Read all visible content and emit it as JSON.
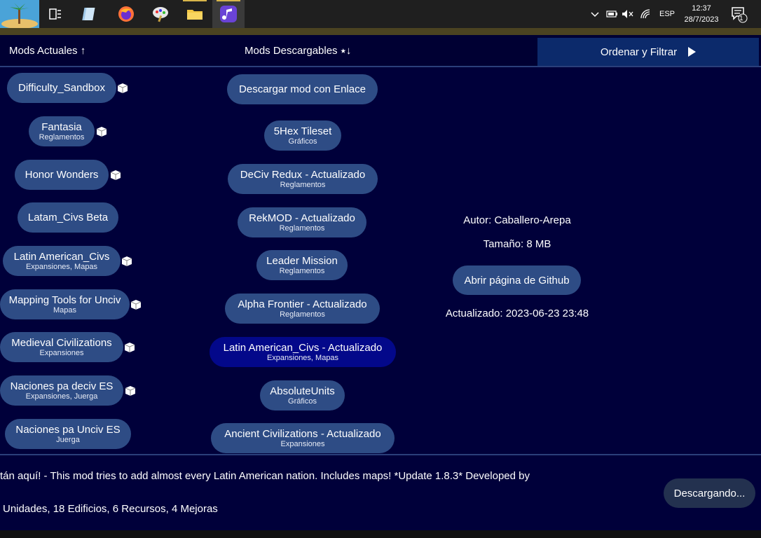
{
  "taskbar": {
    "apps": [
      {
        "icon": "island-icon",
        "name": "game-app"
      },
      {
        "icon": "task-view-icon",
        "name": "task-view"
      },
      {
        "icon": "notebook-icon",
        "name": "notes-app"
      },
      {
        "icon": "firefox-icon",
        "name": "firefox"
      },
      {
        "icon": "paint-icon",
        "name": "paint-app"
      },
      {
        "icon": "folder-icon",
        "name": "file-explorer"
      },
      {
        "icon": "music-icon",
        "name": "music-app"
      }
    ],
    "language": "ESP",
    "time": "12:37",
    "date": "28/7/2023",
    "notification_count": "1"
  },
  "header": {
    "current_mods": "Mods Actuales ↑",
    "downloadable_mods": "Mods Descargables ⭑↓",
    "order_filter": "Ordenar y Filtrar"
  },
  "current_mods": [
    {
      "title": "Difficulty_Sandbox",
      "subtitle": "",
      "installed": true
    },
    {
      "title": "Fantasia",
      "subtitle": "Reglamentos",
      "installed": true
    },
    {
      "title": "Honor Wonders",
      "subtitle": "",
      "installed": true
    },
    {
      "title": "Latam_Civs Beta",
      "subtitle": "",
      "installed": false
    },
    {
      "title": "Latin American_Civs",
      "subtitle": "Expansiones, Mapas",
      "installed": true
    },
    {
      "title": "Mapping Tools for Unciv",
      "subtitle": "Mapas",
      "installed": true
    },
    {
      "title": "Medieval Civilizations",
      "subtitle": "Expansiones",
      "installed": true
    },
    {
      "title": "Naciones pa deciv ES",
      "subtitle": "Expansiones, Juerga",
      "installed": true
    },
    {
      "title": "Naciones pa Unciv ES",
      "subtitle": "Juerga",
      "installed": false
    }
  ],
  "downloadable_mods": [
    {
      "title": "Descargar mod con Enlace",
      "subtitle": ""
    },
    {
      "title": "5Hex Tileset",
      "subtitle": "Gráficos"
    },
    {
      "title": "DeCiv Redux - Actualizado",
      "subtitle": "Reglamentos"
    },
    {
      "title": "RekMOD - Actualizado",
      "subtitle": "Reglamentos"
    },
    {
      "title": "Leader Mission",
      "subtitle": "Reglamentos"
    },
    {
      "title": "Alpha Frontier - Actualizado",
      "subtitle": "Reglamentos"
    },
    {
      "title": "Latin American_Civs - Actualizado",
      "subtitle": "Expansiones, Mapas",
      "selected": true
    },
    {
      "title": "AbsoluteUnits",
      "subtitle": "Gráficos"
    },
    {
      "title": "Ancient Civilizations - Actualizado",
      "subtitle": "Expansiones"
    }
  ],
  "details": {
    "author": "Autor: Caballero-Arepa",
    "size": "Tamaño: 8 MB",
    "github_button": "Abrir página de Github",
    "updated": "Actualizado: 2023-06-23 23:48"
  },
  "description": {
    "line1": "tán aquí! - This mod tries to add almost every Latin American nation. Includes maps!    *Update 1.8.3*     Developed by",
    "line2": "Unidades, 18 Edificios, 6 Recursos, 4 Mejoras"
  },
  "status": {
    "downloading": "Descargando..."
  },
  "colors": {
    "background": "#00003a",
    "pill": "#2e4c85",
    "pill_selected": "#03088a",
    "order_button": "#0c2a6b"
  }
}
